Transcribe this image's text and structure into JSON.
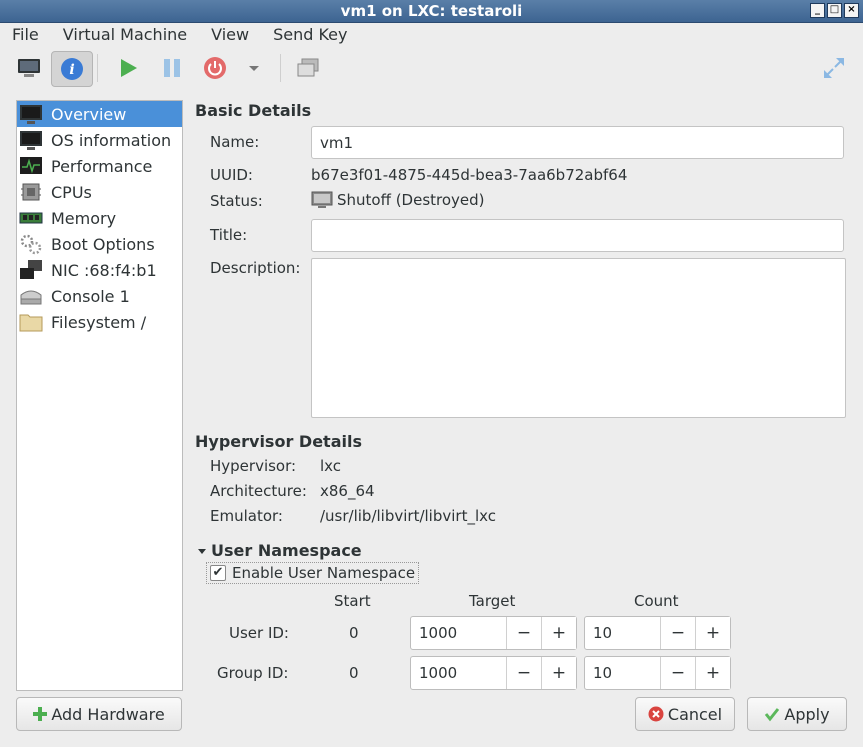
{
  "window": {
    "title": "vm1 on LXC: testaroli"
  },
  "menubar": [
    "File",
    "Virtual Machine",
    "View",
    "Send Key"
  ],
  "toolbar": {
    "buttons": [
      "console-icon",
      "details-icon",
      "run-icon",
      "pause-icon",
      "shutdown-icon",
      "shutdown-menu-icon",
      "snapshots-icon",
      "fullscreen-icon"
    ]
  },
  "sidebar": {
    "items": [
      {
        "label": "Overview",
        "icon": "monitor-icon"
      },
      {
        "label": "OS information",
        "icon": "monitor-icon"
      },
      {
        "label": "Performance",
        "icon": "performance-icon"
      },
      {
        "label": "CPUs",
        "icon": "cpu-icon"
      },
      {
        "label": "Memory",
        "icon": "memory-icon"
      },
      {
        "label": "Boot Options",
        "icon": "boot-icon"
      },
      {
        "label": "NIC :68:f4:b1",
        "icon": "nic-icon"
      },
      {
        "label": "Console 1",
        "icon": "console-icon"
      },
      {
        "label": "Filesystem /",
        "icon": "folder-icon"
      }
    ],
    "add_hardware": "Add Hardware"
  },
  "basic": {
    "title": "Basic Details",
    "name_label": "Name:",
    "name_value": "vm1",
    "uuid_label": "UUID:",
    "uuid_value": "b67e3f01-4875-445d-bea3-7aa6b72abf64",
    "status_label": "Status:",
    "status_value": "Shutoff (Destroyed)",
    "title_label": "Title:",
    "title_value": "",
    "description_label": "Description:"
  },
  "hypervisor": {
    "title": "Hypervisor Details",
    "hypervisor_label": "Hypervisor:",
    "hypervisor_value": "lxc",
    "arch_label": "Architecture:",
    "arch_value": "x86_64",
    "emulator_label": "Emulator:",
    "emulator_value": "/usr/lib/libvirt/libvirt_lxc"
  },
  "userns": {
    "title": "User Namespace",
    "enable_label": "Enable User Namespace",
    "enabled": true,
    "col_start": "Start",
    "col_target": "Target",
    "col_count": "Count",
    "rows": [
      {
        "label": "User ID:",
        "start": "0",
        "target": "1000",
        "count": "10"
      },
      {
        "label": "Group ID:",
        "start": "0",
        "target": "1000",
        "count": "10"
      }
    ],
    "minus": "−",
    "plus": "+"
  },
  "footer": {
    "cancel": "Cancel",
    "apply": "Apply"
  },
  "colors": {
    "selection": "#4a90d9",
    "title_bar": "#3d6491",
    "run_green": "#4caf50",
    "shutdown_red": "#e05252"
  }
}
